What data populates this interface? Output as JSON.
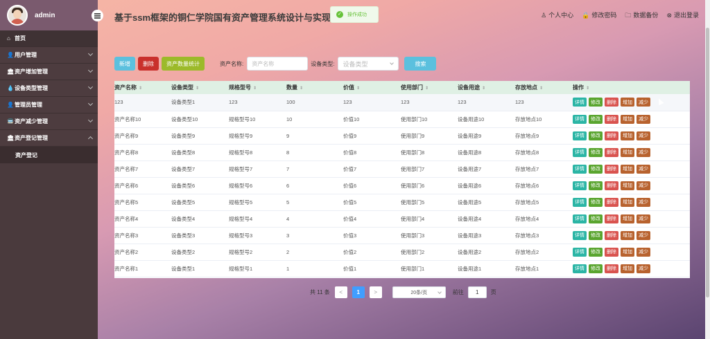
{
  "sidebar": {
    "admin_name": "admin",
    "items": [
      {
        "icon": "⌂",
        "label": "首页",
        "has_chevron": false
      },
      {
        "icon": "👤",
        "label": "用户管理",
        "has_chevron": true
      },
      {
        "icon": "🏛",
        "label": "资产增加管理",
        "has_chevron": true
      },
      {
        "icon": "💧",
        "label": "设备类型管理",
        "has_chevron": true
      },
      {
        "icon": "👤",
        "label": "管理员管理",
        "has_chevron": true
      },
      {
        "icon": "🚍",
        "label": "资产减少管理",
        "has_chevron": true
      },
      {
        "icon": "🏛",
        "label": "资产登记管理",
        "has_chevron": true,
        "expanded": true
      }
    ],
    "submenu": [
      "资产登记"
    ]
  },
  "header": {
    "title": "基于ssm框架的铜仁学院国有资产管理系统设计与实现",
    "toast": "操作成功",
    "links": [
      {
        "icon": "♙",
        "label": "个人中心"
      },
      {
        "icon": "🔒",
        "label": "修改密码"
      },
      {
        "icon": "🗀",
        "label": "数据备份"
      },
      {
        "icon": "⊗",
        "label": "退出登录"
      }
    ]
  },
  "toolbar": {
    "add_label": "新增",
    "delete_label": "删除",
    "stat_label": "资产数量统计",
    "name_label": "资产名称:",
    "name_placeholder": "资产名称",
    "type_label": "设备类型:",
    "type_placeholder": "设备类型",
    "search_label": "搜索"
  },
  "table": {
    "columns": [
      "资产名称",
      "设备类型",
      "规格型号",
      "数量",
      "价值",
      "使用部门",
      "设备用途",
      "存放地点",
      "操作"
    ],
    "ops": [
      "详情",
      "修改",
      "删除",
      "增加",
      "减少"
    ],
    "rows": [
      [
        "123",
        "设备类型1",
        "123",
        "100",
        "123",
        "123",
        "123",
        "123"
      ],
      [
        "资产名称10",
        "设备类型10",
        "规格型号10",
        "10",
        "价值10",
        "使用部门10",
        "设备用途10",
        "存放地点10"
      ],
      [
        "资产名称9",
        "设备类型9",
        "规格型号9",
        "9",
        "价值9",
        "使用部门9",
        "设备用途9",
        "存放地点9"
      ],
      [
        "资产名称8",
        "设备类型8",
        "规格型号8",
        "8",
        "价值8",
        "使用部门8",
        "设备用途8",
        "存放地点8"
      ],
      [
        "资产名称7",
        "设备类型7",
        "规格型号7",
        "7",
        "价值7",
        "使用部门7",
        "设备用途7",
        "存放地点7"
      ],
      [
        "资产名称6",
        "设备类型6",
        "规格型号6",
        "6",
        "价值6",
        "使用部门6",
        "设备用途6",
        "存放地点6"
      ],
      [
        "资产名称5",
        "设备类型5",
        "规格型号5",
        "5",
        "价值5",
        "使用部门5",
        "设备用途5",
        "存放地点5"
      ],
      [
        "资产名称4",
        "设备类型4",
        "规格型号4",
        "4",
        "价值4",
        "使用部门4",
        "设备用途4",
        "存放地点4"
      ],
      [
        "资产名称3",
        "设备类型3",
        "规格型号3",
        "3",
        "价值3",
        "使用部门3",
        "设备用途3",
        "存放地点3"
      ],
      [
        "资产名称2",
        "设备类型2",
        "规格型号2",
        "2",
        "价值2",
        "使用部门2",
        "设备用途2",
        "存放地点2"
      ],
      [
        "资产名称1",
        "设备类型1",
        "规格型号1",
        "1",
        "价值1",
        "使用部门1",
        "设备用途1",
        "存放地点1"
      ]
    ]
  },
  "pagination": {
    "total": "共 11 条",
    "prev": "<",
    "current": "1",
    "next": ">",
    "page_size": "20条/页",
    "goto_label": "前往",
    "goto_value": "1",
    "page_suffix": "页"
  }
}
